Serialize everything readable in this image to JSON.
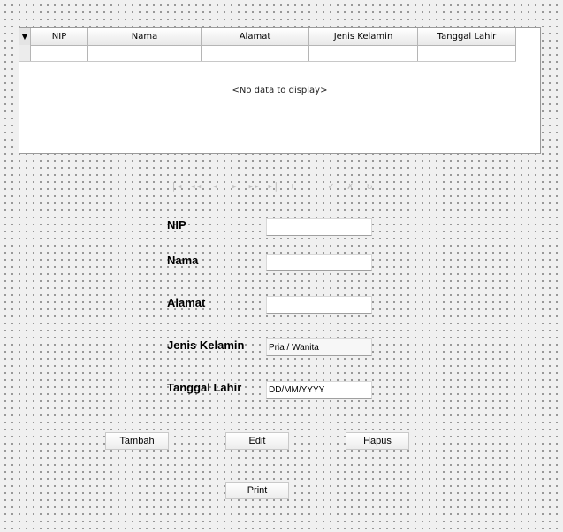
{
  "grid": {
    "indicator": "▼",
    "columns": [
      "NIP",
      "Nama",
      "Alamat",
      "Jenis Kelamin",
      "Tanggal Lahir"
    ],
    "empty_text": "<No data to display>"
  },
  "navigator": {
    "buttons": [
      {
        "name": "first-record-icon",
        "glyph": "|◂"
      },
      {
        "name": "prev-page-icon",
        "glyph": "◂◂"
      },
      {
        "name": "prev-record-icon",
        "glyph": "◂"
      },
      {
        "name": "next-record-icon",
        "glyph": "▸"
      },
      {
        "name": "next-page-icon",
        "glyph": "▸▸"
      },
      {
        "name": "last-record-icon",
        "glyph": "▸|"
      },
      {
        "name": "insert-icon",
        "glyph": "+"
      },
      {
        "name": "delete-icon",
        "glyph": "−"
      },
      {
        "name": "post-icon",
        "glyph": "✓"
      },
      {
        "name": "cancel-icon",
        "glyph": "✗"
      },
      {
        "name": "refresh-icon",
        "glyph": "↻"
      }
    ]
  },
  "form": {
    "nip_label": "NIP",
    "nama_label": "Nama",
    "alamat_label": "Alamat",
    "jk_label": "Jenis Kelamin",
    "tgl_label": "Tanggal Lahir",
    "nip_value": "",
    "nama_value": "",
    "alamat_value": "",
    "jk_value": "Pria / Wanita",
    "tgl_value": "DD/MM/YYYY"
  },
  "buttons": {
    "tambah": "Tambah",
    "edit": "Edit",
    "hapus": "Hapus",
    "print": "Print"
  }
}
